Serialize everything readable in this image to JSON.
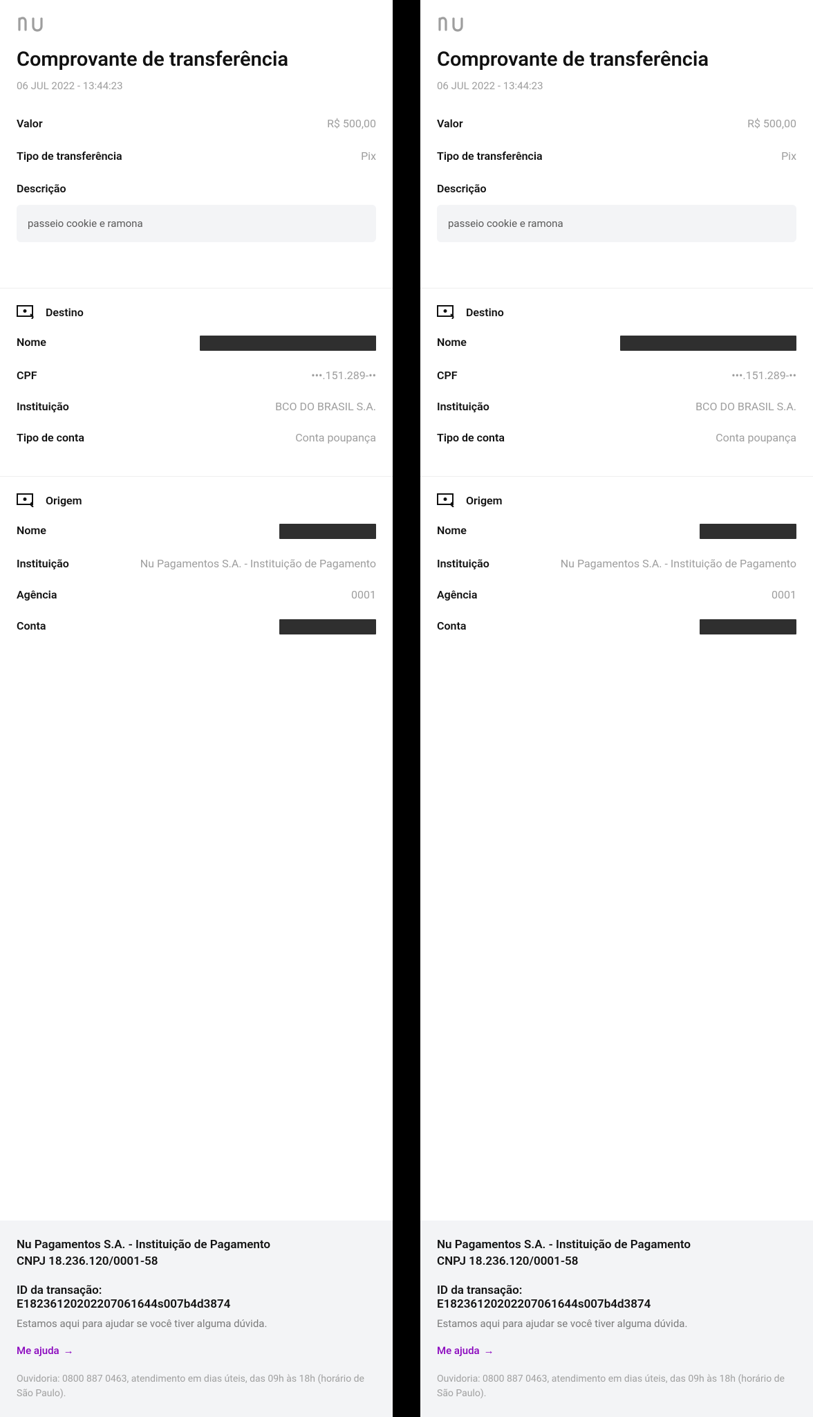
{
  "title": "Comprovante de transferência",
  "datetime": "06 JUL 2022 - 13:44:23",
  "amount_label": "Valor",
  "amount_value": "R$ 500,00",
  "transfer_type_label": "Tipo de transferência",
  "transfer_type_value": "Pix",
  "description_label": "Descrição",
  "description_value": "passeio cookie e ramona",
  "destination": {
    "title": "Destino",
    "name_label": "Nome",
    "cpf_label": "CPF",
    "cpf_value": "•••.151.289-••",
    "institution_label": "Instituição",
    "institution_value": "BCO DO BRASIL S.A.",
    "account_type_label": "Tipo de conta",
    "account_type_value": "Conta poupança"
  },
  "origin": {
    "title": "Origem",
    "name_label": "Nome",
    "institution_label": "Instituição",
    "institution_value": "Nu Pagamentos S.A. - Instituição de Pagamento",
    "agency_label": "Agência",
    "agency_value": "0001",
    "account_label": "Conta"
  },
  "footer": {
    "company": "Nu Pagamentos S.A. - Instituição de Pagamento",
    "cnpj": "CNPJ 18.236.120/0001-58",
    "tx_label": "ID da transação:",
    "tx_id": "E18236120202207061644s007b4d3874",
    "help_text": "Estamos aqui para ajudar se você tiver alguma dúvida.",
    "help_link": "Me ajuda",
    "ouvidoria": "Ouvidoria: 0800 887 0463, atendimento em dias úteis, das 09h às 18h (horário de São Paulo)."
  }
}
